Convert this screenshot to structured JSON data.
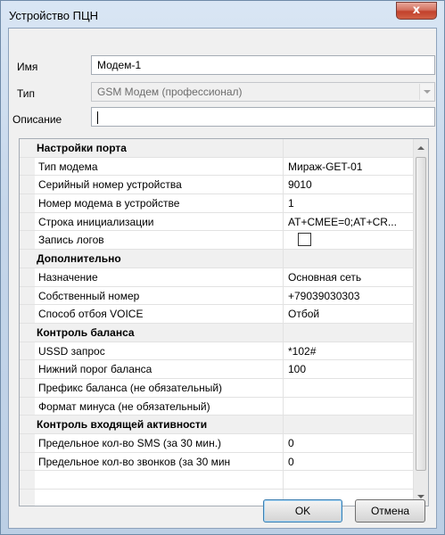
{
  "window": {
    "title": "Устройство ПЦН",
    "close_glyph": "x"
  },
  "form": {
    "name_label": "Имя",
    "name_value": "Модем-1",
    "type_label": "Тип",
    "type_value": "GSM Модем (профессионал)",
    "description_label": "Описание",
    "description_value": ""
  },
  "grid": {
    "rows": [
      {
        "kind": "category",
        "name": "Настройки порта"
      },
      {
        "kind": "prop",
        "name": "Тип модема",
        "value": "Мираж-GET-01"
      },
      {
        "kind": "prop",
        "name": "Серийный номер устройства",
        "value": "9010"
      },
      {
        "kind": "prop",
        "name": "Номер модема в устройстве",
        "value": "1"
      },
      {
        "kind": "prop",
        "name": "Строка инициализации",
        "value": "AT+CMEE=0;AT+CR..."
      },
      {
        "kind": "prop",
        "name": "Запись логов",
        "value": "",
        "checkbox": true,
        "checked": false
      },
      {
        "kind": "category",
        "name": "Дополнительно"
      },
      {
        "kind": "prop",
        "name": "Назначение",
        "value": "Основная сеть"
      },
      {
        "kind": "prop",
        "name": "Собственный номер",
        "value": "+79039030303"
      },
      {
        "kind": "prop",
        "name": "Способ отбоя VOICE",
        "value": "Отбой"
      },
      {
        "kind": "category",
        "name": "Контроль баланса"
      },
      {
        "kind": "prop",
        "name": "USSD запрос",
        "value": "*102#"
      },
      {
        "kind": "prop",
        "name": "Нижний порог баланса",
        "value": "100"
      },
      {
        "kind": "prop",
        "name": "Префикс баланса (не обязательный)",
        "value": ""
      },
      {
        "kind": "prop",
        "name": "Формат минуса (не обязательный)",
        "value": ""
      },
      {
        "kind": "category",
        "name": "Контроль входящей активности"
      },
      {
        "kind": "prop",
        "name": "Предельное кол-во SMS (за 30 мин.)",
        "value": "0"
      },
      {
        "kind": "prop",
        "name": "Предельное кол-во звонков (за 30 мин",
        "value": "0"
      },
      {
        "kind": "prop",
        "name": "",
        "value": ""
      },
      {
        "kind": "prop",
        "name": "",
        "value": ""
      }
    ]
  },
  "buttons": {
    "ok": "OK",
    "cancel": "Отмена"
  },
  "colors": {
    "close_button": "#c2412c",
    "frame": "#c5d6ea"
  }
}
